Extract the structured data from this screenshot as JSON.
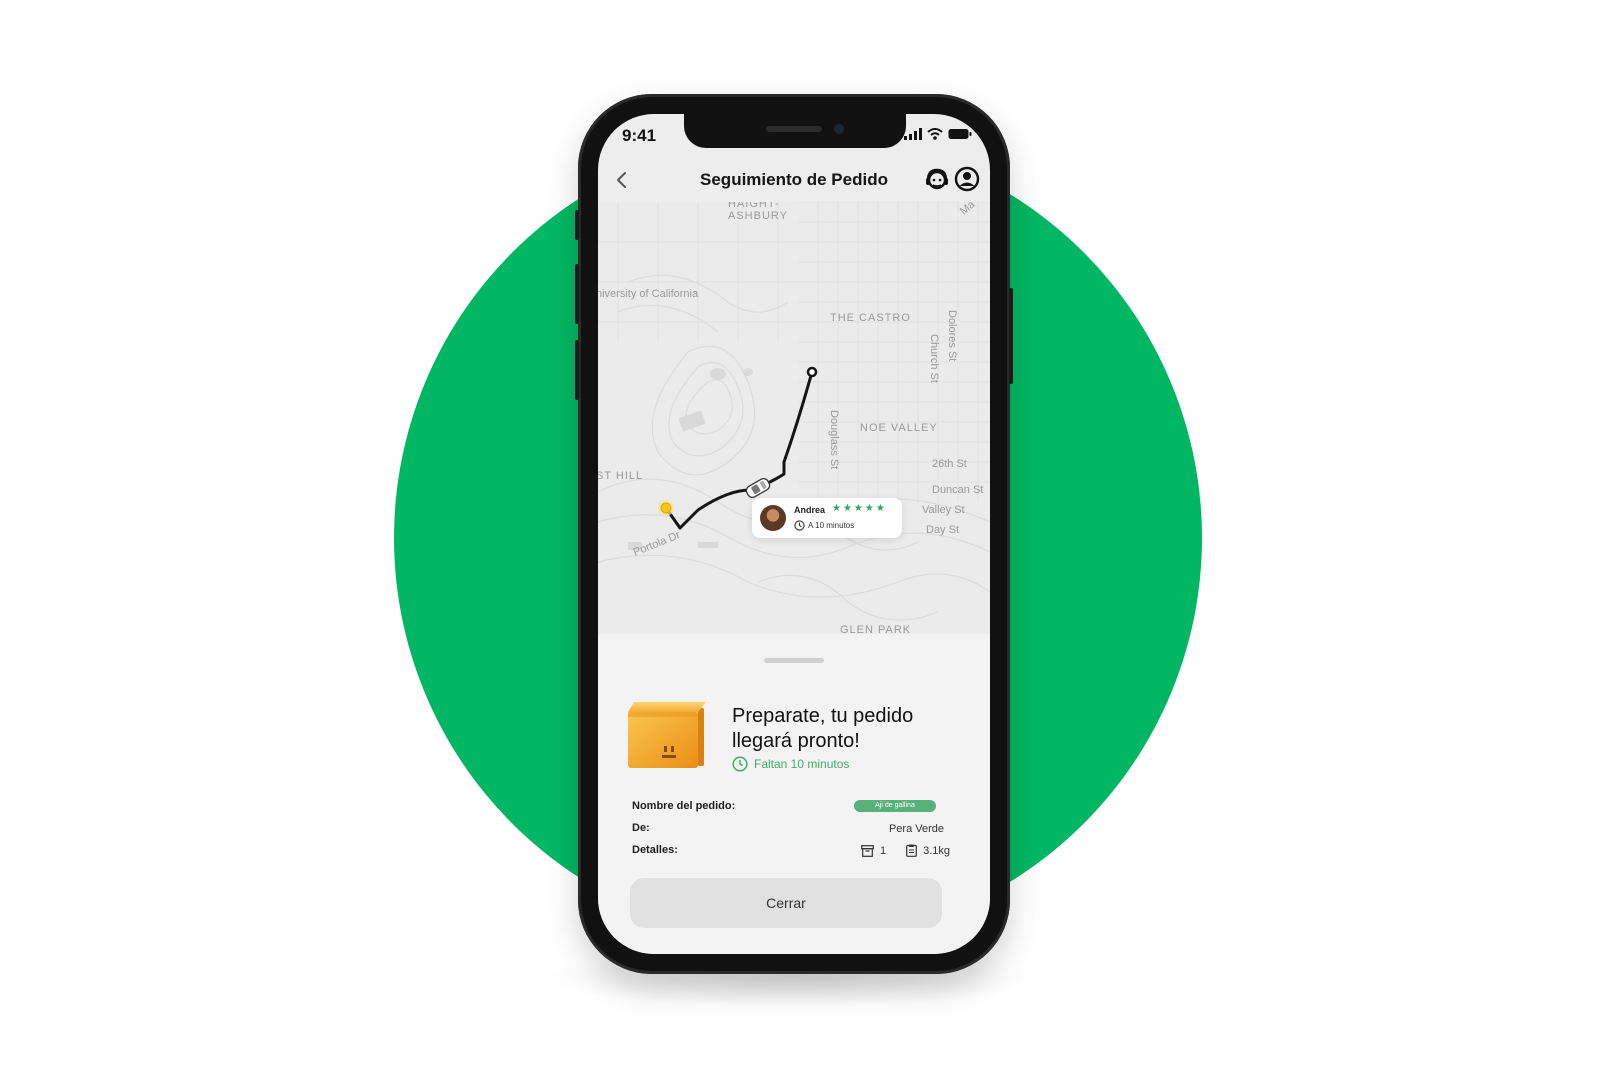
{
  "status_bar": {
    "time": "9:41"
  },
  "header": {
    "title": "Seguimiento de Pedido",
    "back_icon": "chevron-left-icon",
    "support_icon": "support-agent-icon",
    "profile_icon": "user-circle-icon"
  },
  "map": {
    "labels": {
      "haight": "HAIGHT-",
      "ashbury": "ASHBURY",
      "university": "niversity of California",
      "castro": "THE CASTRO",
      "noe_valley": "NOE VALLEY",
      "glen_park": "GLEN PARK",
      "hill": "ST HILL",
      "portola": "Portola Dr",
      "douglass": "Douglass St",
      "church": "Church St",
      "dolores": "Dolores St",
      "st26": "26th St",
      "duncan": "Duncan St",
      "valley": "Valley St",
      "day": "Day St",
      "ma": "Ma"
    },
    "driver": {
      "name": "Andrea",
      "rating": "★★★★★",
      "eta": "A 10 minutos"
    }
  },
  "order": {
    "headline_line1": "Preparate, tu pedido",
    "headline_line2": "llegará pronto!",
    "eta": "Faltan 10 minutos",
    "name_label": "Nombre del pedido:",
    "name_value": "Aji de gallina",
    "from_label": "De:",
    "from_value": "Pera Verde",
    "details_label": "Detalles:",
    "quantity": "1",
    "weight": "3.1kg"
  },
  "close_button": "Cerrar",
  "colors": {
    "brand_green": "#02b763",
    "eta_green": "#3fae68",
    "tag_green": "#58b07a"
  }
}
